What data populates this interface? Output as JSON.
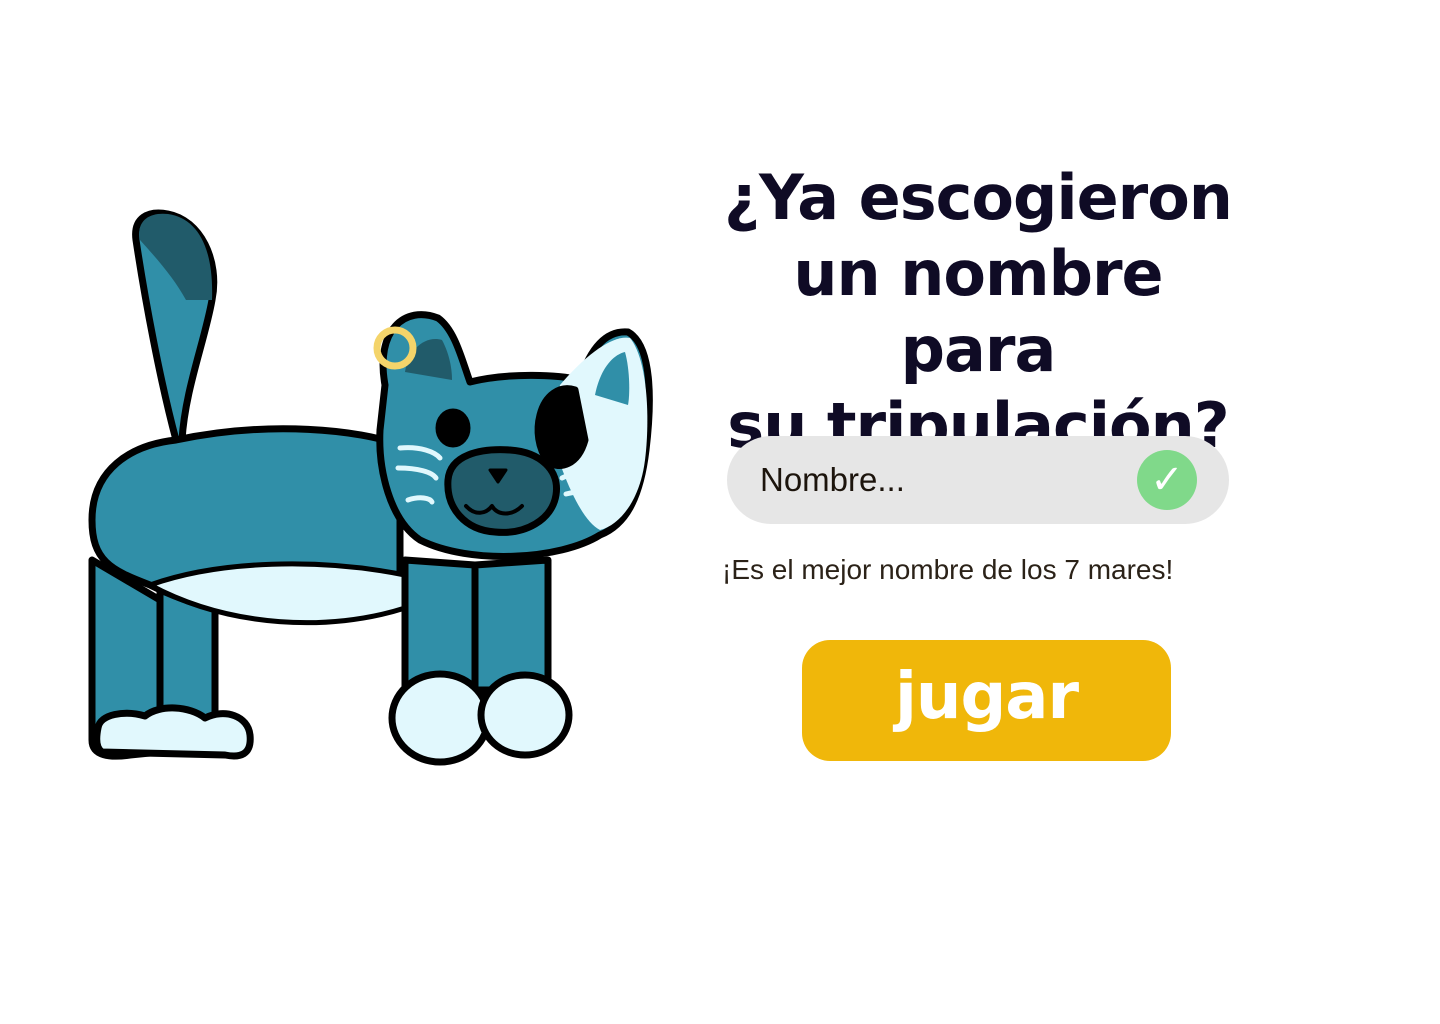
{
  "heading": {
    "line1": "¿Ya escogieron",
    "line2": "un nombre para",
    "line3": "su tripulación?"
  },
  "name_field": {
    "placeholder": "Nombre...",
    "value": "",
    "status_icon": "check-icon",
    "status_glyph": "✓"
  },
  "helper_text": "¡Es el mejor nombre de los 7 mares!",
  "play_button": {
    "label": "jugar"
  },
  "mascot": {
    "icon": "pirate-cat-icon"
  },
  "colors": {
    "heading": "#0f0b25",
    "field_bg": "#e6e6e6",
    "check_bg": "#80d98a",
    "button_bg": "#f0b70a",
    "cat_body": "#308fa8",
    "cat_light": "#e1f8fd",
    "cat_dark": "#215b6a",
    "earring": "#f4d46a"
  }
}
